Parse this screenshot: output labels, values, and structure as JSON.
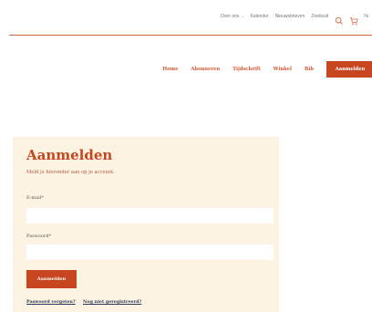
{
  "topbar": {
    "links": [
      "Over ons",
      "Kalender",
      "Nieuwsbrieven",
      "Zoeksuit"
    ],
    "dropdown_caret": "⌄",
    "language": "Ni"
  },
  "mainnav": {
    "items": [
      "Home",
      "Abonneren",
      "Tijdschrift",
      "Winkel",
      "Bib"
    ],
    "login_button": "Aanmelden"
  },
  "login": {
    "title": "Aanmelden",
    "subtitle": "Meld je hieronder aan op je account.",
    "email_label": "E-mail*",
    "email_value": "",
    "password_label": "Paswoord*",
    "password_value": "",
    "submit_label": "Aanmelden",
    "forgot_password": "Paswoord vergeten?",
    "not_registered": "Nog niet geregistreerd?"
  },
  "colors": {
    "accent": "#c8461f",
    "panel": "#fdf3e3",
    "rule": "#d4653f",
    "link_dark": "#2f3a5a"
  },
  "icons": [
    "search-icon",
    "cart-icon"
  ]
}
